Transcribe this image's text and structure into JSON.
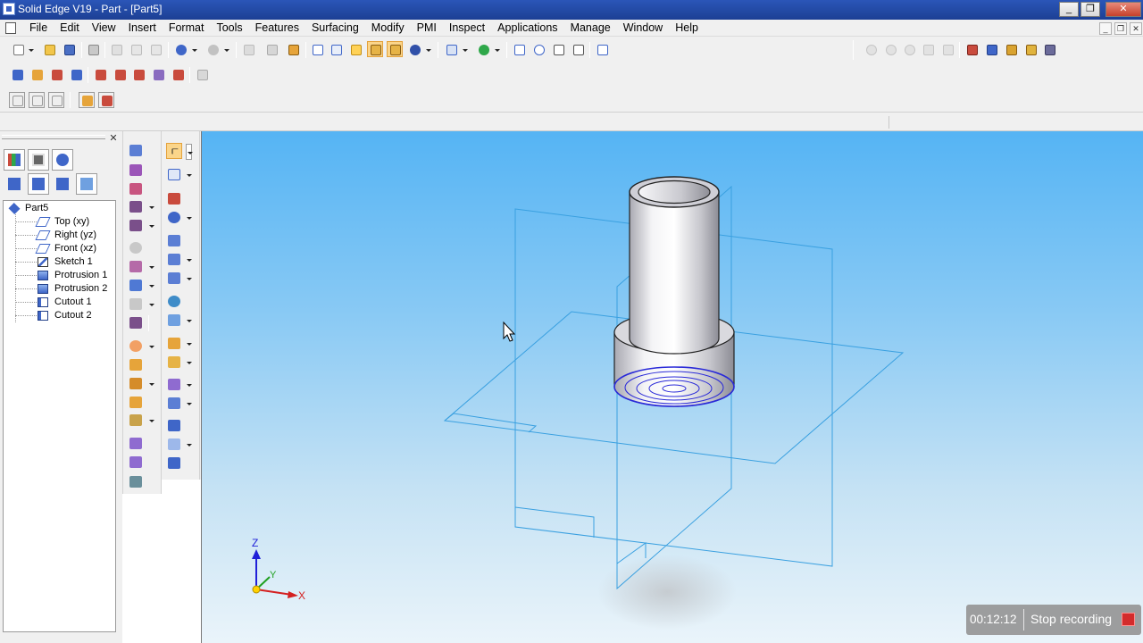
{
  "window": {
    "title": "Solid Edge V19 - Part - [Part5]",
    "controls": [
      "_",
      "❐",
      "✕"
    ]
  },
  "menubar": {
    "items": [
      "File",
      "Edit",
      "View",
      "Insert",
      "Format",
      "Tools",
      "Features",
      "Surfacing",
      "Modify",
      "PMI",
      "Inspect",
      "Applications",
      "Manage",
      "Window",
      "Help"
    ],
    "mdi_controls": [
      "_",
      "❐",
      "✕"
    ]
  },
  "pathfinder": {
    "close_glyph": "✕",
    "tree": [
      {
        "label": "Part5",
        "icon": "part-icon",
        "level": 0
      },
      {
        "label": "Top (xy)",
        "icon": "plane-icon",
        "level": 1
      },
      {
        "label": "Right (yz)",
        "icon": "plane-icon",
        "level": 1
      },
      {
        "label": "Front (xz)",
        "icon": "plane-icon",
        "level": 1
      },
      {
        "label": "Sketch 1",
        "icon": "sketch-icon",
        "level": 1
      },
      {
        "label": "Protrusion 1",
        "icon": "protrusion-icon",
        "level": 1
      },
      {
        "label": "Protrusion 2",
        "icon": "protrusion-icon",
        "level": 1
      },
      {
        "label": "Cutout 1",
        "icon": "cutout-icon",
        "level": 1
      },
      {
        "label": "Cutout 2",
        "icon": "cutout-icon",
        "level": 1
      }
    ]
  },
  "viewport": {
    "triad": {
      "x_label": "X",
      "y_label": "Y",
      "z_label": "Z"
    }
  },
  "recorder": {
    "time": "00:12:12",
    "label": "Stop recording"
  },
  "colors": {
    "titlebar": "#1c3f94",
    "viewport_top": "#55b4f4",
    "viewport_bottom": "#eaf4fa",
    "plane_edges": "#3aa0e0",
    "record_button": "#d32c2c"
  }
}
